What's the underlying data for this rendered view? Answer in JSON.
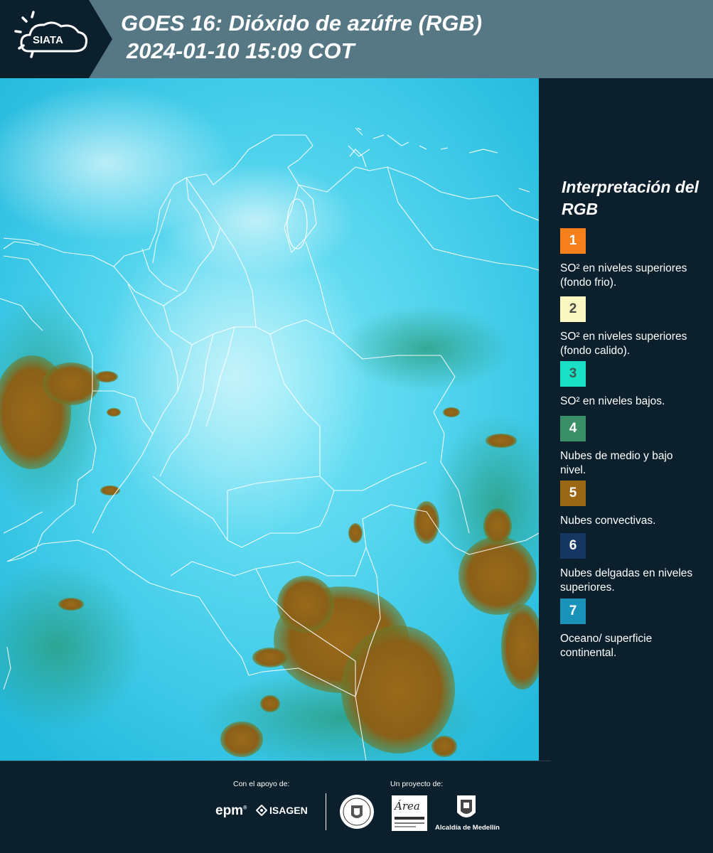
{
  "header": {
    "brand": "SIATA",
    "title_line1": "GOES 16: Dióxido de azúfre (RGB)",
    "title_line2": "2024-01-10 15:09 COT"
  },
  "legend": {
    "title": "Interpretación del RGB",
    "items": [
      {
        "number": "1",
        "color": "#f6801b",
        "text_color": "#ffffff",
        "description": "SO² en niveles superiores (fondo frio)."
      },
      {
        "number": "2",
        "color": "#fbf8c1",
        "text_color": "#4a4a4a",
        "description": "SO² en niveles superiores (fondo calido)."
      },
      {
        "number": "3",
        "color": "#1ae0c6",
        "text_color": "#3a5a55",
        "description": "SO² en niveles bajos."
      },
      {
        "number": "4",
        "color": "#3a8f66",
        "text_color": "#ffffff",
        "description": "Nubes de medio y bajo nivel."
      },
      {
        "number": "5",
        "color": "#9a6814",
        "text_color": "#ffffff",
        "description": "Nubes convectivas."
      },
      {
        "number": "6",
        "color": "#173763",
        "text_color": "#ffffff",
        "description": "Nubes delgadas en niveles superiores."
      },
      {
        "number": "7",
        "color": "#1b93b9",
        "text_color": "#ffffff",
        "description": "Oceano/ superficie continental."
      }
    ]
  },
  "footer": {
    "support_label": "Con el apoyo de:",
    "project_label": "Un proyecto de:",
    "epm": "epm",
    "isagen": "ISAGEN",
    "area_metro": "Área",
    "alcaldia": "Alcaldía de Medellín"
  },
  "colors": {
    "header_bg": "#557884",
    "dark_bg": "#0b1f2c",
    "map_base": "#35c4e6",
    "convective": "#9a6814"
  }
}
